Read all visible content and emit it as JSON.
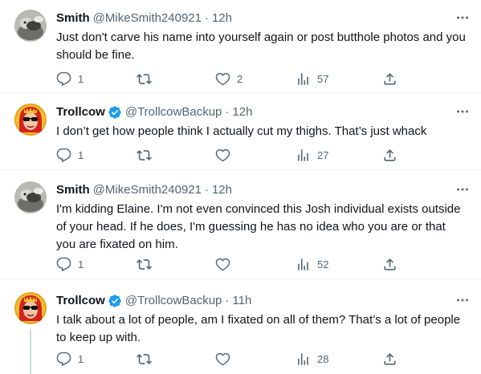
{
  "tweets": [
    {
      "name": "Smith",
      "handle": "@MikeSmith240921",
      "separator": "·",
      "time": "12h",
      "verified": false,
      "text": "Just don't carve his name into yourself again or post butthole photos and you should be fine.",
      "replies": "1",
      "retweets": "",
      "likes": "2",
      "views": "57"
    },
    {
      "name": "Trollcow",
      "handle": "@TrollcowBackup",
      "separator": "·",
      "time": "12h",
      "verified": true,
      "text": "I don’t get how people think I actually cut my thighs. That’s just whack",
      "replies": "1",
      "retweets": "",
      "likes": "",
      "views": "27"
    },
    {
      "name": "Smith",
      "handle": "@MikeSmith240921",
      "separator": "·",
      "time": "12h",
      "verified": false,
      "text": "I'm kidding Elaine. I'm not even convinced this Josh individual exists outside of your head. If he does, I'm guessing he has no idea who you are or that you are fixated on him.",
      "replies": "1",
      "retweets": "",
      "likes": "",
      "views": "52"
    },
    {
      "name": "Trollcow",
      "handle": "@TrollcowBackup",
      "separator": "·",
      "time": "11h",
      "verified": true,
      "text": "I talk about a lot of people, am I fixated on all of them? That’s a lot of people to keep up with.",
      "replies": "1",
      "retweets": "",
      "likes": "",
      "views": "28"
    }
  ],
  "icons": {
    "reply": "reply-icon",
    "retweet": "retweet-icon",
    "like": "heart-icon",
    "views": "views-chart-icon",
    "share": "share-icon",
    "more": "more-options-icon",
    "verified": "verified-badge-icon"
  },
  "colors": {
    "text": "#0f1419",
    "secondary": "#536471",
    "verified": "#1d9bf0",
    "divider": "#eff3f4",
    "thread_line": "#cfd9de"
  }
}
